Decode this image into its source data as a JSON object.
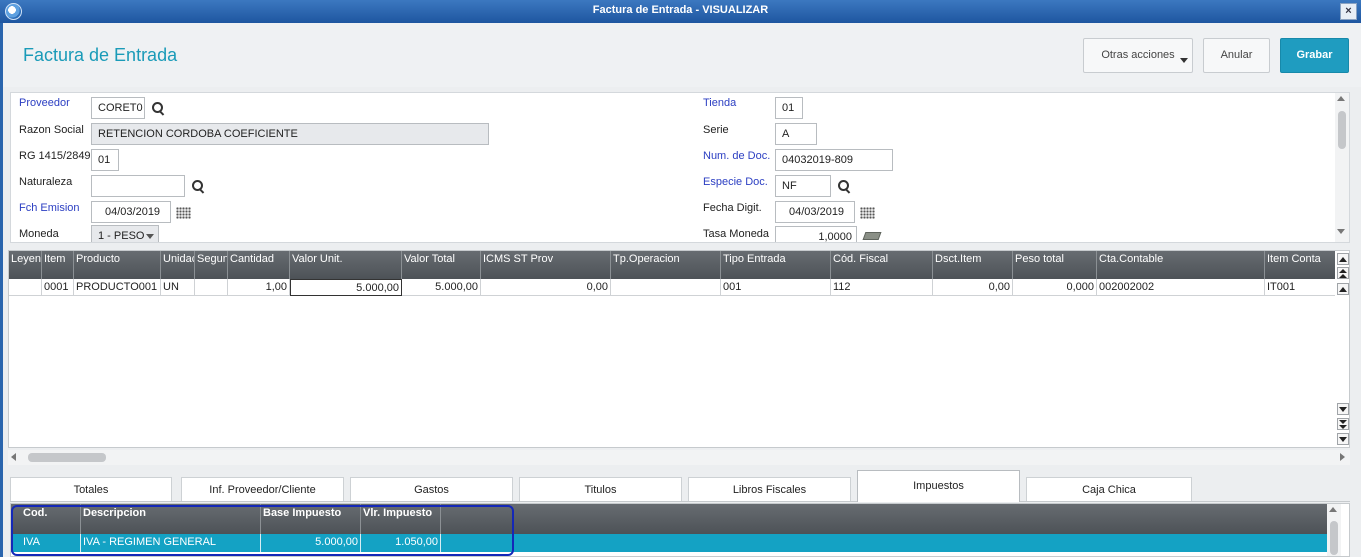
{
  "window": {
    "title": "Factura de Entrada - VISUALIZAR",
    "close": "×"
  },
  "header": {
    "title": "Factura de Entrada",
    "btn_otras": "Otras acciones",
    "btn_anular": "Anular",
    "btn_grabar": "Grabar"
  },
  "form": {
    "proveedor_label": "Proveedor",
    "proveedor_value": "CORET0",
    "razon_label": "Razon Social",
    "razon_value": "RETENCION CORDOBA COEFICIENTE",
    "rg_label": "RG 1415/2849",
    "rg_value": "01",
    "naturaleza_label": "Naturaleza",
    "naturaleza_value": "",
    "fch_emision_label": "Fch Emision",
    "fch_emision_value": "04/03/2019",
    "moneda_label": "Moneda",
    "moneda_value": "1 - PESO",
    "tienda_label": "Tienda",
    "tienda_value": "01",
    "serie_label": "Serie",
    "serie_value": "A",
    "num_doc_label": "Num. de Doc.",
    "num_doc_value": "04032019-809",
    "especie_label": "Especie Doc.",
    "especie_value": "NF",
    "fecha_digit_label": "Fecha Digit.",
    "fecha_digit_value": "04/03/2019",
    "tasa_label": "Tasa Moneda",
    "tasa_value": "1,0000"
  },
  "items": {
    "columns": [
      "Leyen",
      "Item",
      "Producto",
      "Unidac",
      "Segun",
      "Cantidad",
      "Valor Unit.",
      "Valor Total",
      "ICMS ST Prov",
      "Tp.Operacion",
      "Tipo Entrada",
      "Cód. Fiscal",
      "Dsct.Item",
      "Peso total",
      "Cta.Contable",
      "Item Conta"
    ],
    "rows": [
      [
        "",
        "0001",
        "PRODUCTO001",
        "UN",
        "",
        "1,00",
        "5.000,00",
        "5.000,00",
        "0,00",
        "",
        "001",
        "112",
        "0,00",
        "0,000",
        "002002002",
        "IT001"
      ]
    ]
  },
  "tabs": [
    "Totales",
    "Inf. Proveedor/Cliente",
    "Gastos",
    "Titulos",
    "Libros Fiscales",
    "Impuestos",
    "Caja Chica"
  ],
  "active_tab": "Impuestos",
  "taxes": {
    "columns": [
      "Cod.",
      "Descripcion",
      "Base Impuesto",
      "Vlr. Impuesto"
    ],
    "rows": [
      [
        "IVA",
        "IVA - REGIMEN GENERAL",
        "5.000,00",
        "1.050,00"
      ]
    ]
  },
  "colors": {
    "accent": "#1f9cc0",
    "title": "#1a9bb8",
    "selected_row": "#14a2c4",
    "highlight": "#1428b8",
    "required_label": "#2b3ec2"
  }
}
